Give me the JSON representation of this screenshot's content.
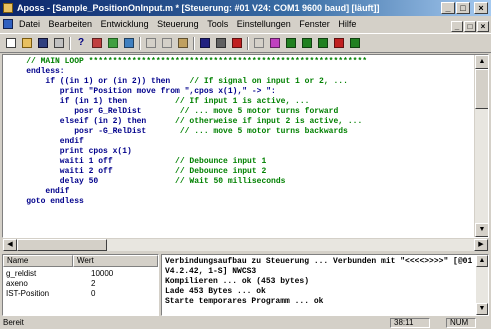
{
  "window": {
    "title": "Aposs - [Sample_PositionOnInput.m * [Steuerung: #01 V24: COM1 9600 baud] [läuft]]",
    "controls": [
      "_",
      "□",
      "×"
    ]
  },
  "menubar": {
    "items": [
      "Datei",
      "Bearbeiten",
      "Entwicklung",
      "Steuerung",
      "Tools",
      "Einstellungen",
      "Fenster",
      "Hilfe"
    ],
    "mdi_controls": [
      "_",
      "□",
      "×"
    ]
  },
  "toolbar": {
    "buttons": [
      "new-file",
      "open-file",
      "save-file",
      "print",
      "help",
      "compile",
      "download",
      "start",
      "cut",
      "copy",
      "paste",
      "find",
      "find-next",
      "replace",
      "break",
      "debug",
      "grid",
      "monitor",
      "chart",
      "stop",
      "panel"
    ]
  },
  "editor": {
    "lines": [
      {
        "parts": [
          {
            "t": "    // MAIN LOOP **********************************************************",
            "c": "cm"
          }
        ]
      },
      {
        "parts": [
          {
            "t": "    endless:",
            "c": "kw"
          }
        ]
      },
      {
        "parts": [
          {
            "t": "        if ((in 1) or (in 2)) then    // If signal on input 1 or 2, ...",
            "c": "kw"
          }
        ]
      },
      {
        "parts": [
          {
            "t": "           print \"Position move from \",cpos x(1),\" -> \":",
            "c": "kw"
          }
        ]
      },
      {
        "parts": [
          {
            "t": "           if (in 1) then          // If input 1 is active, ...",
            "c": "kw"
          }
        ]
      },
      {
        "parts": [
          {
            "t": "              posr G_RelDist        // ... move 5 motor turns forward",
            "c": "kw"
          }
        ]
      },
      {
        "parts": [
          {
            "t": "           elseif (in 2) then      // otherweise if input 2 is active, ...",
            "c": "kw"
          }
        ]
      },
      {
        "parts": [
          {
            "t": "              posr -G_RelDist       // ... move 5 motor turns backwards",
            "c": "kw"
          }
        ]
      },
      {
        "parts": [
          {
            "t": "           endif",
            "c": "kw"
          }
        ]
      },
      {
        "parts": [
          {
            "t": "           print cpos x(1)",
            "c": "kw"
          }
        ]
      },
      {
        "parts": [
          {
            "t": "           waiti 1 off             // Debounce input 1",
            "c": "kw"
          }
        ]
      },
      {
        "parts": [
          {
            "t": "           waiti 2 off             // Debounce input 2",
            "c": "kw"
          }
        ]
      },
      {
        "parts": [
          {
            "t": "           delay 50                // Wait 50 milliseconds",
            "c": "kw"
          }
        ]
      },
      {
        "parts": [
          {
            "t": "        endif",
            "c": "kw"
          }
        ]
      },
      {
        "parts": [
          {
            "t": "    goto endless",
            "c": "kw"
          }
        ]
      }
    ]
  },
  "variables": {
    "headers": [
      "Name",
      "Wert"
    ],
    "rows": [
      {
        "name": "g_reldist",
        "value": "10000"
      },
      {
        "name": "axeno",
        "value": "2"
      },
      {
        "name": "IST-Position",
        "value": "0"
      }
    ]
  },
  "output": {
    "lines": [
      "Verbindungsaufbau zu Steuerung ... Verbunden mit \"<<<<>>>>\" [@01 V24",
      "V4.2.42, 1-S] NWCS3",
      "Kompilieren ... ok (453 bytes)",
      "Lade 453 Bytes ... ok",
      "Starte temporares Programm ... ok"
    ]
  },
  "statusbar": {
    "left": "Bereit",
    "position": "38:11",
    "num": "NUM"
  }
}
